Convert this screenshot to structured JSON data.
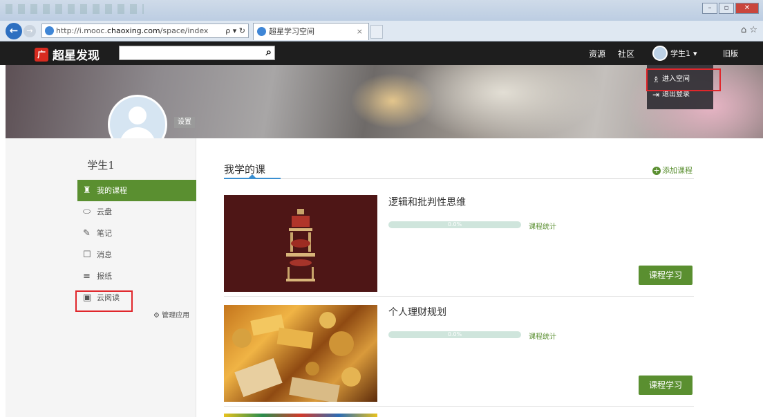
{
  "browser": {
    "url_prefix": "http://i.mooc.",
    "url_domain": "chaoxing.com",
    "url_path": "/space/index",
    "url_tools": "ρ ▾ ↻",
    "tab_title": "超星学习空间",
    "tab_close": "×",
    "back_glyph": "←",
    "forward_glyph": "→",
    "toolbar_icons": "⌂ ☆",
    "window_buttons": [
      "–",
      "▫",
      "✕"
    ]
  },
  "site": {
    "logo_mark": "广",
    "logo_text": "超星发现",
    "search_placeholder": "",
    "search_icon": "⌕",
    "nav": [
      "资源",
      "社区"
    ],
    "user_name": "学生1",
    "user_caret": "▾",
    "old_version": "旧版"
  },
  "dropdown": {
    "items": [
      {
        "label": "进入空间",
        "icon": "♗"
      },
      {
        "label": "退出登录",
        "icon": "⇥"
      }
    ]
  },
  "profile": {
    "set_label": "设置",
    "username": "学生1"
  },
  "sidebar": {
    "items": [
      {
        "label": "我的课程",
        "icon": "♜",
        "active": true
      },
      {
        "label": "云盘",
        "icon": "⬭",
        "active": false
      },
      {
        "label": "笔记",
        "icon": "✎",
        "active": false
      },
      {
        "label": "消息",
        "icon": "☐",
        "active": false
      },
      {
        "label": "报纸",
        "icon": "≡",
        "active": false
      },
      {
        "label": "云阅读",
        "icon": "▣",
        "active": false
      }
    ],
    "manage_icon": "⚙",
    "manage_label": "管理应用"
  },
  "main": {
    "title": "我学的课",
    "add_icon": "+",
    "add_label": "添加课程",
    "courses": [
      {
        "name": "逻辑和批判性思维",
        "progress_text": "0.0%",
        "progress": 0,
        "stats_label": "课程统计",
        "study_label": "课程学习"
      },
      {
        "name": "个人理财规划",
        "progress_text": "0.0%",
        "progress": 0,
        "stats_label": "课程统计",
        "study_label": "课程学习"
      }
    ]
  },
  "colors": {
    "accent_green": "#5a8f30",
    "highlight_red": "#e0262b",
    "progress_track": "#cfe5dc"
  }
}
